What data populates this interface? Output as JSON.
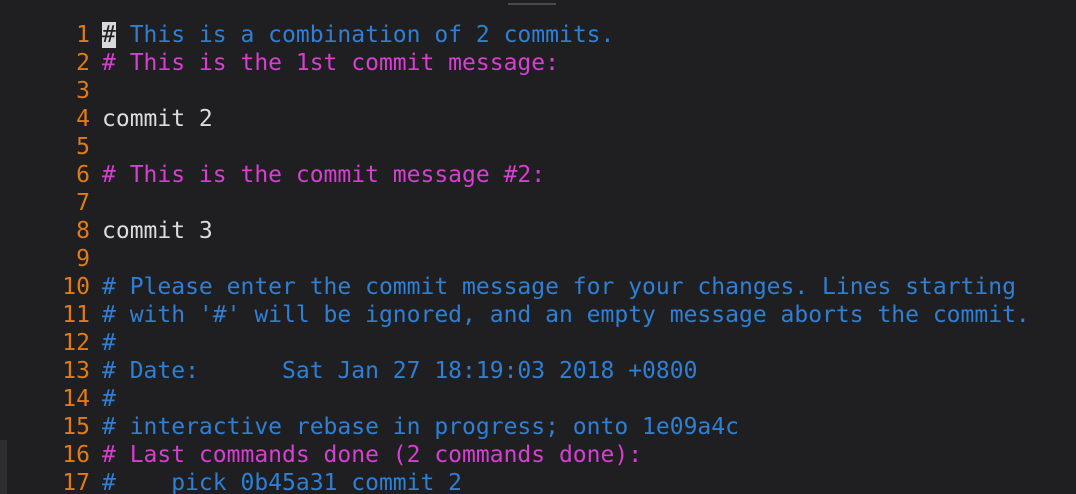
{
  "editor": {
    "lines": [
      {
        "number": "1",
        "cursor_char": "#",
        "text": " This is a combination of 2 commits."
      },
      {
        "number": "2",
        "text": "# This is the 1st commit message:"
      },
      {
        "number": "3",
        "text": ""
      },
      {
        "number": "4",
        "text": "commit 2"
      },
      {
        "number": "5",
        "text": ""
      },
      {
        "number": "6",
        "text": "# This is the commit message #2:"
      },
      {
        "number": "7",
        "text": ""
      },
      {
        "number": "8",
        "text": "commit 3"
      },
      {
        "number": "9",
        "text": ""
      },
      {
        "number": "10",
        "text": "# Please enter the commit message for your changes. Lines starting"
      },
      {
        "number": "11",
        "text": "# with '#' will be ignored, and an empty message aborts the commit."
      },
      {
        "number": "12",
        "text": "#"
      },
      {
        "number": "13",
        "text": "# Date:      Sat Jan 27 18:19:03 2018 +0800"
      },
      {
        "number": "14",
        "text": "#"
      },
      {
        "number": "15",
        "text": "# interactive rebase in progress; onto 1e09a4c"
      },
      {
        "number": "16",
        "text": "# Last commands done (2 commands done):"
      },
      {
        "number": "17",
        "text": "#    pick 0b45a31 commit 2"
      }
    ]
  },
  "colors": {
    "background": "#1f1f21",
    "line_number": "#e07b1a",
    "comment_blue": "#2f7fd4",
    "comment_magenta": "#d63fd1",
    "plain_text": "#dcdcdc",
    "cursor": "#d9d9d9"
  }
}
